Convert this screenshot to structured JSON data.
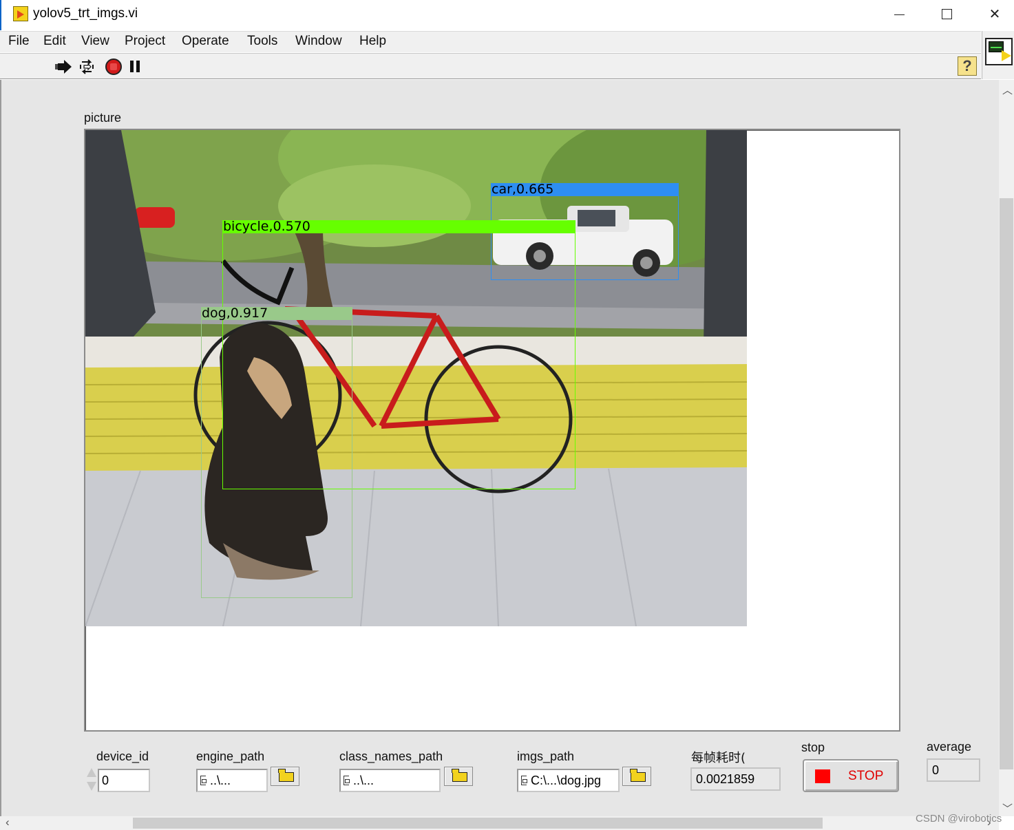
{
  "window": {
    "title": "yolov5_trt_imgs.vi"
  },
  "menu": [
    "File",
    "Edit",
    "View",
    "Project",
    "Operate",
    "Tools",
    "Window",
    "Help"
  ],
  "toolbar": {
    "run_icon": "run-arrow-icon",
    "continuous_icon": "run-continuously-icon",
    "abort_icon": "abort-icon",
    "pause_icon": "pause-icon",
    "help_label": "?"
  },
  "picture": {
    "label": "picture",
    "detections": [
      {
        "label": "car,0.665",
        "color": "#2e8ef2"
      },
      {
        "label": "bicycle,0.570",
        "color": "#66ff00"
      },
      {
        "label": "dog,0.917",
        "color": "#99c98a"
      }
    ]
  },
  "controls": {
    "device_id": {
      "label": "device_id",
      "value": "0"
    },
    "engine_path": {
      "label": "engine_path",
      "value": "..\\..."
    },
    "class_names_path": {
      "label": "class_names_path",
      "value": "..\\..."
    },
    "imgs_path": {
      "label": "imgs_path",
      "value": "C:\\...\\dog.jpg"
    },
    "frame_time": {
      "label": "每帧耗时(",
      "value": "0.0021859"
    },
    "stop": {
      "label": "stop",
      "button_text": "STOP"
    },
    "average": {
      "label": "average",
      "value": "0"
    }
  },
  "watermark": "CSDN @virobotics"
}
